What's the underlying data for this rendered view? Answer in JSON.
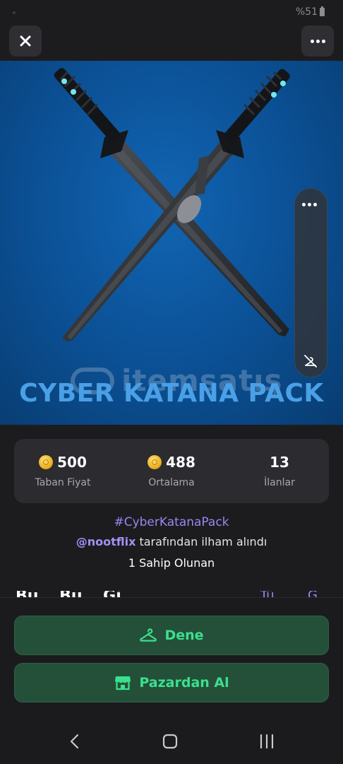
{
  "status_bar": {
    "battery": "%51"
  },
  "hero": {
    "watermark": "itemsatış",
    "title": "CYBER KATANA PACK"
  },
  "stats": [
    {
      "value": "500",
      "label": "Taban Fiyat",
      "icon": "coin-icon"
    },
    {
      "value": "488",
      "label": "Ortalama",
      "icon": "coin-icon"
    },
    {
      "value": "13",
      "label": "İlanlar"
    }
  ],
  "info": {
    "hashtag": "#CyberKatanaPack",
    "creator_handle": "@nootflix",
    "creator_suffix": " tarafından ilham alındı",
    "owners": "1 Sahip Olunan"
  },
  "section": {
    "title": "Bu… Bü… Gi…",
    "link": "Tü… … G…"
  },
  "actions": {
    "try_label": "Dene",
    "buy_label": "Pazardan Al"
  },
  "colors": {
    "accent_green": "#3be08e",
    "button_bg": "#245039",
    "accent_purple": "#9b86f0",
    "title_blue": "#4aa0e6"
  },
  "icons": [
    "close-icon",
    "more-icon",
    "hanger-icon",
    "store-icon",
    "back-icon",
    "home-icon",
    "recents-icon",
    "hide-icon"
  ]
}
